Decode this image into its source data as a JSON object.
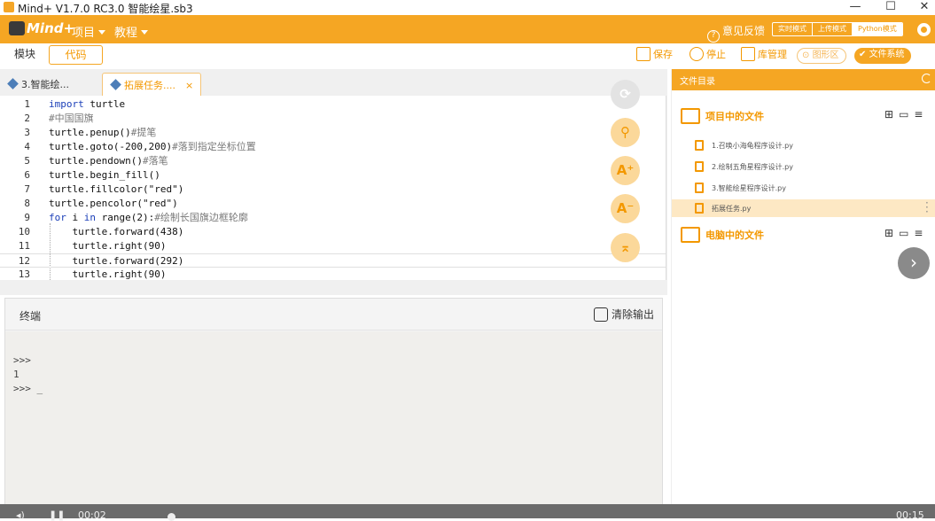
{
  "window": {
    "title": "Mind+ V1.7.0 RC3.0  智能绘星.sb3",
    "minimize": "—",
    "maximize": "☐",
    "close": "✕"
  },
  "menubar": {
    "brand": "Mind+",
    "menus": [
      "项目",
      "教程"
    ],
    "feedback": "意见反馈",
    "modes": [
      "实时模式",
      "上传模式",
      "Python模式"
    ],
    "active_mode": "Python模式"
  },
  "toolbar": {
    "tab_blocks": "模块",
    "tab_code": "代码",
    "save": "保存",
    "stop": "停止",
    "library": "库管理",
    "graphics": "图形区",
    "filesystem": "文件系统"
  },
  "editor": {
    "tabs": [
      {
        "label": "3.智能绘...",
        "active": false
      },
      {
        "label": "拓展任务....",
        "active": true
      }
    ],
    "tab_close": "×",
    "lines": [
      {
        "n": "1",
        "text": "import turtle"
      },
      {
        "n": "2",
        "text": "#中国国旗"
      },
      {
        "n": "3",
        "text": "turtle.penup()#提笔"
      },
      {
        "n": "4",
        "text": "turtle.goto(-200,200)#落到指定坐标位置"
      },
      {
        "n": "5",
        "text": "turtle.pendown()#落笔"
      },
      {
        "n": "6",
        "text": "turtle.begin_fill()"
      },
      {
        "n": "7",
        "text": "turtle.fillcolor(\"red\")"
      },
      {
        "n": "8",
        "text": "turtle.pencolor(\"red\")"
      },
      {
        "n": "9",
        "text": "for i in range(2):#绘制长国旗边框轮廓"
      },
      {
        "n": "10",
        "text": "    turtle.forward(438)"
      },
      {
        "n": "11",
        "text": "    turtle.right(90)"
      },
      {
        "n": "12",
        "text": "    turtle.forward(292)"
      },
      {
        "n": "13",
        "text": "    turtle.right(90)"
      }
    ],
    "side_buttons": [
      "refresh-icon",
      "search-icon",
      "font-increase-icon",
      "font-decrease-icon",
      "collapse-up-icon"
    ]
  },
  "terminal": {
    "title": "终端",
    "clear": "清除输出",
    "lines": [
      ">>>",
      "1",
      ">>> _"
    ]
  },
  "files": {
    "header": "文件目录",
    "project_section": "项目中的文件",
    "project_files": [
      "1.召唤小海龟程序设计.py",
      "2.绘制五角星程序设计.py",
      "3.智能绘星程序设计.py",
      "拓展任务.py"
    ],
    "selected_file": "拓展任务.py",
    "computer_section": "电脑中的文件"
  },
  "video": {
    "current_time": "00:02",
    "total_time": "00:15"
  },
  "colors": {
    "accent": "#f5a623",
    "accent_text": "#f39800",
    "keyword": "#1b3fb8"
  }
}
